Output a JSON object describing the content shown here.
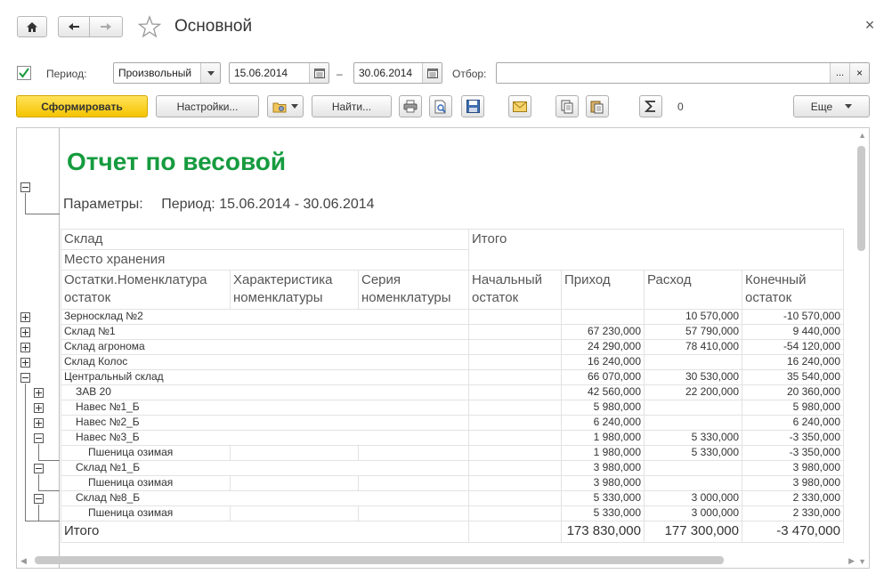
{
  "window": {
    "title": "Основной",
    "close_glyph": "×"
  },
  "filters": {
    "period_enabled": true,
    "period_label": "Период:",
    "period_type": "Произвольный",
    "date_from": "15.06.2014",
    "dash": "–",
    "date_to": "30.06.2014",
    "filter_label": "Отбор:",
    "filter_value": "",
    "filter_choose": "...",
    "filter_clear": "×"
  },
  "toolbar": {
    "generate_label": "Сформировать",
    "settings_label": "Настройки...",
    "find_label": "Найти...",
    "sum_value": "0",
    "more_label": "Еще"
  },
  "icons": {
    "home": "home-icon",
    "back": "arrow-left-icon",
    "forward": "arrow-right-icon",
    "favorite": "star-icon",
    "calendar": "calendar-icon",
    "variants": "report-variant-icon",
    "print": "printer-icon",
    "preview": "print-preview-icon",
    "save": "save-icon",
    "mail": "envelope-icon",
    "copy": "copy-icon",
    "paste": "paste-icon",
    "sum": "sigma-icon"
  },
  "report": {
    "title": "Отчет по весовой",
    "params_label": "Параметры:",
    "params_value": "Период: 15.06.2014 - 30.06.2014",
    "headers": {
      "warehouse": "Склад",
      "total": "Итого",
      "storage": "Место хранения",
      "item": "Остатки.Номенклатура остаток",
      "characteristic": "Характеристика номенклатуры",
      "series": "Серия номенклатуры",
      "opening": "Начальный остаток",
      "income": "Приход",
      "expense": "Расход",
      "closing": "Конечный остаток"
    },
    "rows": [
      {
        "name": "Зерносклад №2",
        "opening": "",
        "income": "",
        "expense": "10 570,000",
        "closing": "-10 570,000"
      },
      {
        "name": "Склад №1",
        "opening": "",
        "income": "67 230,000",
        "expense": "57 790,000",
        "closing": "9 440,000"
      },
      {
        "name": "Склад агронома",
        "opening": "",
        "income": "24 290,000",
        "expense": "78 410,000",
        "closing": "-54 120,000"
      },
      {
        "name": "Склад Колос",
        "opening": "",
        "income": "16 240,000",
        "expense": "",
        "closing": "16 240,000"
      },
      {
        "name": "Центральный склад",
        "opening": "",
        "income": "66 070,000",
        "expense": "30 530,000",
        "closing": "35 540,000"
      },
      {
        "name": "ЗАВ 20",
        "opening": "",
        "income": "42 560,000",
        "expense": "22 200,000",
        "closing": "20 360,000"
      },
      {
        "name": "Навес №1_Б",
        "opening": "",
        "income": "5 980,000",
        "expense": "",
        "closing": "5 980,000"
      },
      {
        "name": "Навес №2_Б",
        "opening": "",
        "income": "6 240,000",
        "expense": "",
        "closing": "6 240,000"
      },
      {
        "name": "Навес №3_Б",
        "opening": "",
        "income": "1 980,000",
        "expense": "5 330,000",
        "closing": "-3 350,000"
      },
      {
        "name": "Пшеница озимая",
        "opening": "",
        "income": "1 980,000",
        "expense": "5 330,000",
        "closing": "-3 350,000"
      },
      {
        "name": "Склад №1_Б",
        "opening": "",
        "income": "3 980,000",
        "expense": "",
        "closing": "3 980,000"
      },
      {
        "name": "Пшеница озимая",
        "opening": "",
        "income": "3 980,000",
        "expense": "",
        "closing": "3 980,000"
      },
      {
        "name": "Склад №8_Б",
        "opening": "",
        "income": "5 330,000",
        "expense": "3 000,000",
        "closing": "2 330,000"
      },
      {
        "name": "Пшеница озимая",
        "opening": "",
        "income": "5 330,000",
        "expense": "3 000,000",
        "closing": "2 330,000"
      }
    ],
    "totals": {
      "label": "Итого",
      "opening": "",
      "income": "173 830,000",
      "expense": "177 300,000",
      "closing": "-3 470,000"
    }
  }
}
